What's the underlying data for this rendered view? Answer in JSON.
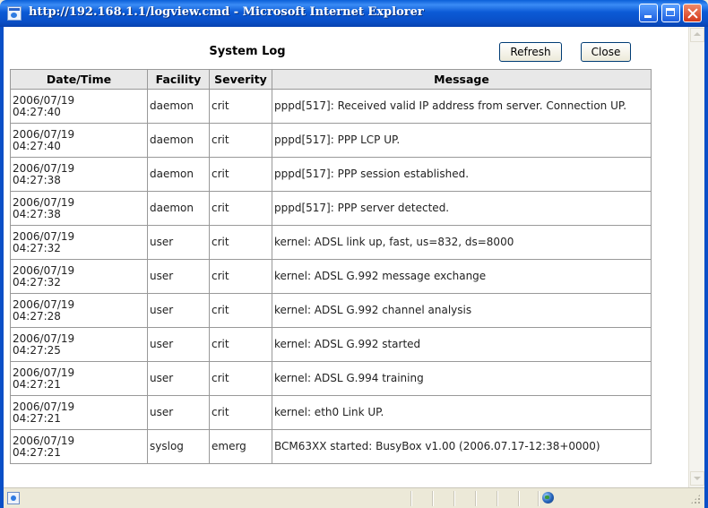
{
  "window": {
    "title": "http://192.168.1.1/logview.cmd - Microsoft Internet Explorer",
    "icon": "ie-page-icon",
    "controls": [
      "minimize-icon",
      "maximize-icon",
      "close-icon"
    ]
  },
  "page": {
    "title": "System Log",
    "refresh_label": "Refresh",
    "close_label": "Close"
  },
  "table": {
    "columns": [
      "Date/Time",
      "Facility",
      "Severity",
      "Message"
    ],
    "rows": [
      {
        "date": "2006/07/19",
        "time": "04:27:40",
        "facility": "daemon",
        "severity": "crit",
        "message": "pppd[517]: Received valid IP address from server. Connection UP."
      },
      {
        "date": "2006/07/19",
        "time": "04:27:40",
        "facility": "daemon",
        "severity": "crit",
        "message": "pppd[517]: PPP LCP UP."
      },
      {
        "date": "2006/07/19",
        "time": "04:27:38",
        "facility": "daemon",
        "severity": "crit",
        "message": "pppd[517]: PPP session established."
      },
      {
        "date": "2006/07/19",
        "time": "04:27:38",
        "facility": "daemon",
        "severity": "crit",
        "message": "pppd[517]: PPP server detected."
      },
      {
        "date": "2006/07/19",
        "time": "04:27:32",
        "facility": "user",
        "severity": "crit",
        "message": "kernel: ADSL link up, fast, us=832, ds=8000"
      },
      {
        "date": "2006/07/19",
        "time": "04:27:32",
        "facility": "user",
        "severity": "crit",
        "message": "kernel: ADSL G.992 message exchange"
      },
      {
        "date": "2006/07/19",
        "time": "04:27:28",
        "facility": "user",
        "severity": "crit",
        "message": "kernel: ADSL G.992 channel analysis"
      },
      {
        "date": "2006/07/19",
        "time": "04:27:25",
        "facility": "user",
        "severity": "crit",
        "message": "kernel: ADSL G.992 started"
      },
      {
        "date": "2006/07/19",
        "time": "04:27:21",
        "facility": "user",
        "severity": "crit",
        "message": "kernel: ADSL G.994 training"
      },
      {
        "date": "2006/07/19",
        "time": "04:27:21",
        "facility": "user",
        "severity": "crit",
        "message": "kernel: eth0 Link UP."
      },
      {
        "date": "2006/07/19",
        "time": "04:27:21",
        "facility": "syslog",
        "severity": "emerg",
        "message": "BCM63XX started: BusyBox v1.00 (2006.07.17-12:38+0000)"
      }
    ]
  },
  "statusbar": {
    "page_icon": "ie-page-icon",
    "zone_icon": "internet-zone-globe-icon"
  },
  "colors": {
    "titlebar": "#0a4fc7",
    "header_bg": "#e8e8e8",
    "grid": "#999999",
    "window_bg": "#ece9d8"
  }
}
